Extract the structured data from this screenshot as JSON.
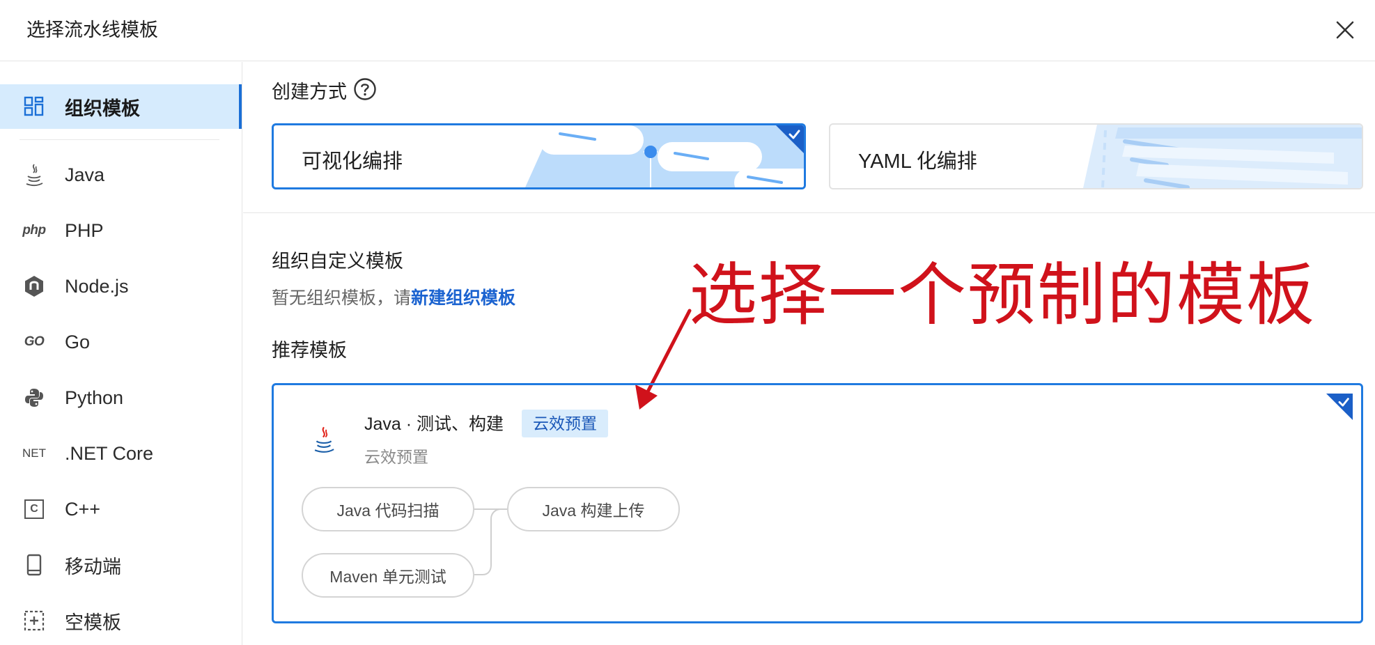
{
  "header": {
    "title": "选择流水线模板"
  },
  "sidebar": {
    "items": [
      {
        "label": "组织模板",
        "icon": "grid-icon"
      },
      {
        "label": "Java",
        "icon": "java-icon"
      },
      {
        "label": "PHP",
        "icon": "php-icon",
        "icon_text": "php"
      },
      {
        "label": "Node.js",
        "icon": "nodejs-icon"
      },
      {
        "label": "Go",
        "icon": "go-icon",
        "icon_text": "GO"
      },
      {
        "label": "Python",
        "icon": "python-icon"
      },
      {
        "label": ".NET Core",
        "icon": "dotnet-icon",
        "icon_text": "NET"
      },
      {
        "label": "C++",
        "icon": "cpp-icon",
        "icon_text": "C"
      },
      {
        "label": "移动端",
        "icon": "mobile-icon"
      },
      {
        "label": "空模板",
        "icon": "empty-template-icon"
      }
    ]
  },
  "create_mode": {
    "label": "创建方式",
    "options": [
      {
        "label": "可视化编排",
        "selected": true
      },
      {
        "label": "YAML 化编排",
        "selected": false
      }
    ]
  },
  "org_templates": {
    "label": "组织自定义模板",
    "empty_text": "暂无组织模板，请",
    "create_link": "新建组织模板"
  },
  "recommended": {
    "label": "推荐模板",
    "template": {
      "name": "Java · 测试、构建",
      "badge": "云效预置",
      "subtitle": "云效预置",
      "selected": true,
      "stages": [
        "Java 代码扫描",
        "Maven 单元测试",
        "Java 构建上传"
      ]
    }
  },
  "annotation": {
    "text": "选择一个预制的模板",
    "color": "#d0121b"
  },
  "colors": {
    "accent": "#1f7ae0",
    "active_bg": "#d6ebfd",
    "link": "#1b63d0"
  }
}
